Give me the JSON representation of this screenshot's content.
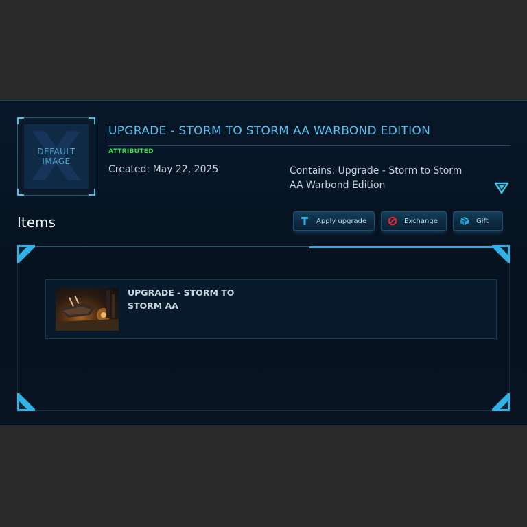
{
  "pledge": {
    "thumbnail_text": "DEFAULT IMAGE",
    "thumbnail_line1": "DEFAULT",
    "thumbnail_line2": "IMAGE",
    "title": "UPGRADE - STORM TO STORM AA WARBOND EDITION",
    "status_badge": "ATTRIBUTED",
    "created": "Created: May 22, 2025",
    "contains": "Contains: Upgrade - Storm to Storm AA Warbond Edition",
    "expand_icon": "triangle-down-icon"
  },
  "items_section": {
    "heading": "Items",
    "actions": [
      {
        "label": "Apply upgrade",
        "icon": "hammer-icon"
      },
      {
        "label": "Exchange",
        "icon": "no-entry-icon"
      },
      {
        "label": "Gift",
        "icon": "gift-cube-icon"
      }
    ],
    "items": [
      {
        "title": "UPGRADE - STORM TO STORM AA",
        "image": "ship-scene-thumbnail"
      }
    ]
  },
  "colors": {
    "page_background": "#2a2a2b",
    "panel_background": "#08182a",
    "accent_cyan": "#55c4f0",
    "status_green": "#33e04a",
    "exchange_icon_red": "#e3262b"
  }
}
